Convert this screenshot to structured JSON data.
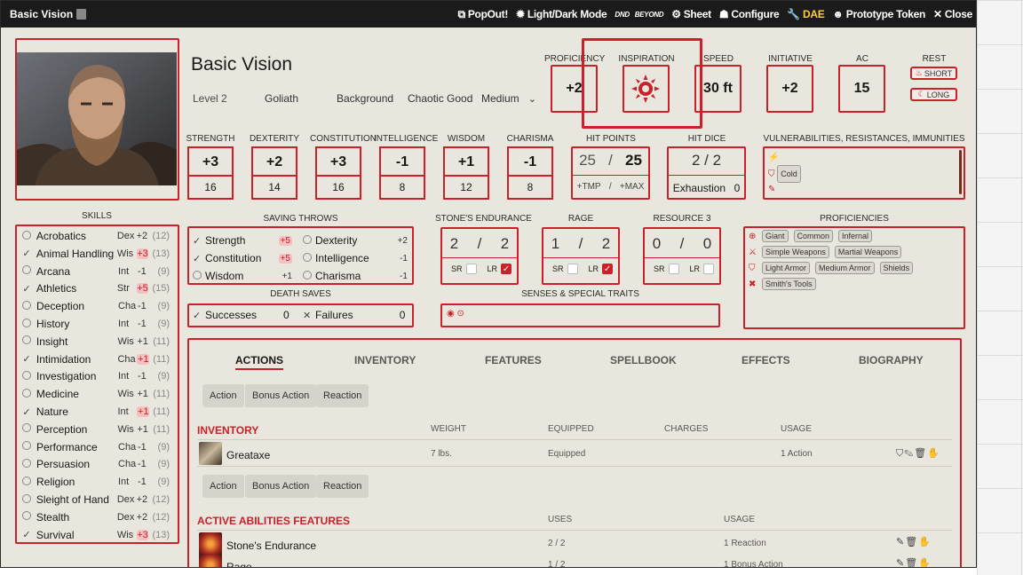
{
  "window": {
    "title": "Basic Vision",
    "header_buttons": {
      "popout": "PopOut!",
      "light_dark": "Light/Dark Mode",
      "dndb_top": "DND",
      "dndb_bottom": "BEYOND",
      "sheet": "Sheet",
      "configure": "Configure",
      "dae": "DAE",
      "prototype_token": "Prototype Token",
      "close": "Close"
    }
  },
  "character": {
    "name": "Basic Vision",
    "level": "Level 2",
    "race": "Goliath",
    "background": "Background",
    "alignment": "Chaotic Good",
    "size": "Medium"
  },
  "top_stats": {
    "proficiency_label": "Proficiency",
    "proficiency": "+2",
    "inspiration_label": "Inspiration",
    "speed_label": "Speed",
    "speed": "30 ft",
    "initiative_label": "Initiative",
    "initiative": "+2",
    "ac_label": "AC",
    "ac": "15",
    "rest_label": "Rest",
    "short": "SHORT",
    "long": "LONG"
  },
  "abilities": [
    {
      "label": "Strength",
      "mod": "+3",
      "score": "16"
    },
    {
      "label": "Dexterity",
      "mod": "+2",
      "score": "14"
    },
    {
      "label": "Constitution",
      "mod": "+3",
      "score": "16"
    },
    {
      "label": "Intelligence",
      "mod": "-1",
      "score": "8"
    },
    {
      "label": "Wisdom",
      "mod": "+1",
      "score": "12"
    },
    {
      "label": "Charisma",
      "mod": "-1",
      "score": "8"
    }
  ],
  "hit_points": {
    "label": "Hit Points",
    "current": "25",
    "sep": "/",
    "max": "25",
    "tmp": "+TMP",
    "tmax": "+MAX"
  },
  "hit_dice": {
    "label": "Hit Dice",
    "value": "2 / 2",
    "exhaustion_label": "Exhaustion",
    "exhaustion": "0"
  },
  "vulnerabilities": {
    "label": "Vulnerabilities, Resistances, Immunities",
    "resist_tag": "Cold"
  },
  "skills_label": "Skills",
  "skills": [
    {
      "name": "Acrobatics",
      "ability": "Dex",
      "mod": "+2",
      "passive": "(12)",
      "prof": false,
      "hi": false
    },
    {
      "name": "Animal Handling",
      "ability": "Wis",
      "mod": "+3",
      "passive": "(13)",
      "prof": true,
      "hi": true
    },
    {
      "name": "Arcana",
      "ability": "Int",
      "mod": "-1",
      "passive": "(9)",
      "prof": false,
      "hi": false
    },
    {
      "name": "Athletics",
      "ability": "Str",
      "mod": "+5",
      "passive": "(15)",
      "prof": true,
      "hi": true
    },
    {
      "name": "Deception",
      "ability": "Cha",
      "mod": "-1",
      "passive": "(9)",
      "prof": false,
      "hi": false
    },
    {
      "name": "History",
      "ability": "Int",
      "mod": "-1",
      "passive": "(9)",
      "prof": false,
      "hi": false
    },
    {
      "name": "Insight",
      "ability": "Wis",
      "mod": "+1",
      "passive": "(11)",
      "prof": false,
      "hi": false
    },
    {
      "name": "Intimidation",
      "ability": "Cha",
      "mod": "+1",
      "passive": "(11)",
      "prof": true,
      "hi": true
    },
    {
      "name": "Investigation",
      "ability": "Int",
      "mod": "-1",
      "passive": "(9)",
      "prof": false,
      "hi": false
    },
    {
      "name": "Medicine",
      "ability": "Wis",
      "mod": "+1",
      "passive": "(11)",
      "prof": false,
      "hi": false
    },
    {
      "name": "Nature",
      "ability": "Int",
      "mod": "+1",
      "passive": "(11)",
      "prof": true,
      "hi": true
    },
    {
      "name": "Perception",
      "ability": "Wis",
      "mod": "+1",
      "passive": "(11)",
      "prof": false,
      "hi": false
    },
    {
      "name": "Performance",
      "ability": "Cha",
      "mod": "-1",
      "passive": "(9)",
      "prof": false,
      "hi": false
    },
    {
      "name": "Persuasion",
      "ability": "Cha",
      "mod": "-1",
      "passive": "(9)",
      "prof": false,
      "hi": false
    },
    {
      "name": "Religion",
      "ability": "Int",
      "mod": "-1",
      "passive": "(9)",
      "prof": false,
      "hi": false
    },
    {
      "name": "Sleight of Hand",
      "ability": "Dex",
      "mod": "+2",
      "passive": "(12)",
      "prof": false,
      "hi": false
    },
    {
      "name": "Stealth",
      "ability": "Dex",
      "mod": "+2",
      "passive": "(12)",
      "prof": false,
      "hi": false
    },
    {
      "name": "Survival",
      "ability": "Wis",
      "mod": "+3",
      "passive": "(13)",
      "prof": true,
      "hi": true
    }
  ],
  "saving_throws": {
    "label": "Saving Throws",
    "items": [
      {
        "name": "Strength",
        "mod": "+5",
        "prof": true,
        "hi": true
      },
      {
        "name": "Dexterity",
        "mod": "+2",
        "prof": false,
        "hi": false
      },
      {
        "name": "Constitution",
        "mod": "+5",
        "prof": true,
        "hi": true
      },
      {
        "name": "Intelligence",
        "mod": "-1",
        "prof": false,
        "hi": false
      },
      {
        "name": "Wisdom",
        "mod": "+1",
        "prof": false,
        "hi": false
      },
      {
        "name": "Charisma",
        "mod": "-1",
        "prof": false,
        "hi": false
      }
    ]
  },
  "death_saves": {
    "label": "Death Saves",
    "successes_label": "Successes",
    "successes": "0",
    "failures_label": "Failures",
    "failures": "0"
  },
  "resources": [
    {
      "label": "Stone's Endurance",
      "value": "2",
      "max": "2",
      "sr": false,
      "lr": true
    },
    {
      "label": "Rage",
      "value": "1",
      "max": "2",
      "sr": false,
      "lr": true
    },
    {
      "label": "Resource 3",
      "value": "0",
      "max": "0",
      "sr": false,
      "lr": false
    }
  ],
  "resource_sr": "SR",
  "resource_lr": "LR",
  "resource_sep": "/",
  "senses_label": "Senses & Special Traits",
  "proficiencies": {
    "label": "Proficiencies",
    "languages": [
      "Giant",
      "Common",
      "Infernal"
    ],
    "weapons": [
      "Simple Weapons",
      "Martial Weapons"
    ],
    "armor": [
      "Light Armor",
      "Medium Armor",
      "Shields"
    ],
    "tools": [
      "Smith's Tools"
    ]
  },
  "tabs": [
    "Actions",
    "Inventory",
    "Features",
    "Spellbook",
    "Effects",
    "Biography"
  ],
  "filters": [
    "Action",
    "Bonus Action",
    "Reaction"
  ],
  "inventory_section": {
    "title": "Inventory",
    "cols": [
      "Weight",
      "Equipped",
      "Charges",
      "Usage"
    ],
    "items": [
      {
        "name": "Greataxe",
        "weight": "7 lbs.",
        "equipped": "Equipped",
        "usage": "1 Action"
      }
    ]
  },
  "abilities_section": {
    "title": "Active Abilities Features",
    "cols": [
      "Uses",
      "Usage"
    ],
    "items": [
      {
        "name": "Stone's Endurance",
        "uses": "2 / 2",
        "usage": "1 Reaction"
      },
      {
        "name": "Rage",
        "uses": "1 / 2",
        "usage": "1 Bonus Action"
      }
    ]
  },
  "colors": {
    "accent": "#c9202a",
    "parchment": "#e9e6dd",
    "titlebar": "#1b1b1b",
    "dae": "#ffd12a"
  }
}
